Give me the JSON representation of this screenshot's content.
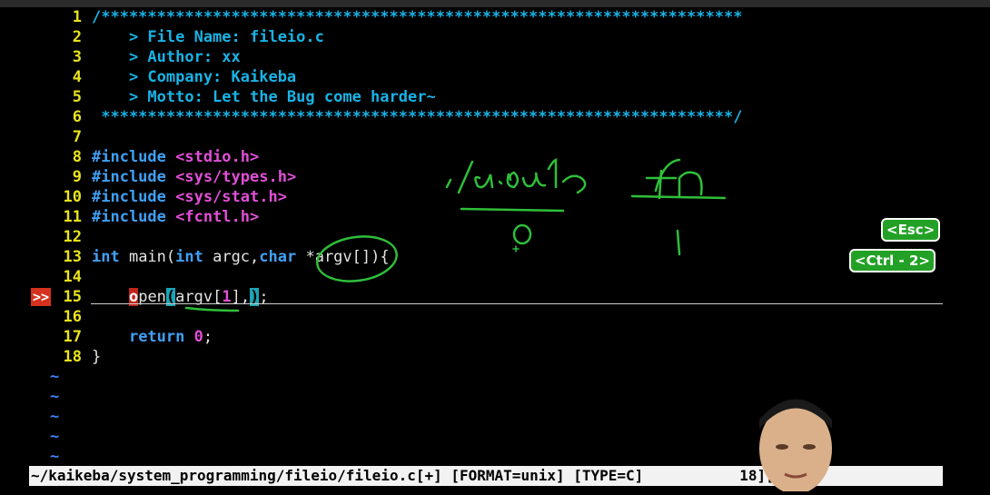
{
  "editor": {
    "lines": [
      {
        "num": "1",
        "segments": [
          {
            "cls": "cm",
            "text": "/*********************************************************************"
          }
        ]
      },
      {
        "num": "2",
        "segments": [
          {
            "cls": "cm",
            "text": "    > File Name: fileio.c"
          }
        ]
      },
      {
        "num": "3",
        "segments": [
          {
            "cls": "cm",
            "text": "    > Author: xx"
          }
        ]
      },
      {
        "num": "4",
        "segments": [
          {
            "cls": "cm",
            "text": "    > Company: Kaikeba"
          }
        ]
      },
      {
        "num": "5",
        "segments": [
          {
            "cls": "cm",
            "text": "    > Motto: Let the Bug come harder~"
          }
        ]
      },
      {
        "num": "6",
        "segments": [
          {
            "cls": "cm",
            "text": " ********************************************************************/"
          }
        ]
      },
      {
        "num": "7",
        "segments": []
      },
      {
        "num": "8",
        "segments": [
          {
            "cls": "pp",
            "text": "#include "
          },
          {
            "cls": "inc",
            "text": "<stdio.h>"
          }
        ]
      },
      {
        "num": "9",
        "segments": [
          {
            "cls": "pp",
            "text": "#include "
          },
          {
            "cls": "inc",
            "text": "<sys/types.h>"
          }
        ]
      },
      {
        "num": "10",
        "segments": [
          {
            "cls": "pp",
            "text": "#include "
          },
          {
            "cls": "inc",
            "text": "<sys/stat.h>"
          }
        ]
      },
      {
        "num": "11",
        "segments": [
          {
            "cls": "pp",
            "text": "#include "
          },
          {
            "cls": "inc",
            "text": "<fcntl.h>"
          }
        ]
      },
      {
        "num": "12",
        "segments": []
      },
      {
        "num": "13",
        "segments": [
          {
            "cls": "kw",
            "text": "int"
          },
          {
            "cls": "tx",
            "text": " main("
          },
          {
            "cls": "kw",
            "text": "int"
          },
          {
            "cls": "tx",
            "text": " argc,"
          },
          {
            "cls": "kw",
            "text": "char"
          },
          {
            "cls": "tx",
            "text": " *argv[]){"
          }
        ]
      },
      {
        "num": "14",
        "segments": []
      },
      {
        "num": "15",
        "segments": [
          {
            "cls": "tx",
            "text": "    "
          },
          {
            "cls": "cursor-hl",
            "text": "o"
          },
          {
            "cls": "tx",
            "text": "pen"
          },
          {
            "cls": "paren-hl",
            "text": "("
          },
          {
            "cls": "tx",
            "text": "argv["
          },
          {
            "cls": "numlit",
            "text": "1"
          },
          {
            "cls": "tx",
            "text": "],"
          },
          {
            "cls": "paren-hl",
            "text": ")"
          },
          {
            "cls": "tx",
            "text": ";"
          }
        ]
      },
      {
        "num": "16",
        "segments": []
      },
      {
        "num": "17",
        "segments": [
          {
            "cls": "tx",
            "text": "    "
          },
          {
            "cls": "kw",
            "text": "return"
          },
          {
            "cls": "tx",
            "text": " "
          },
          {
            "cls": "numlit",
            "text": "0"
          },
          {
            "cls": "tx",
            "text": ";"
          }
        ]
      },
      {
        "num": "18",
        "segments": [
          {
            "cls": "tx",
            "text": "}"
          }
        ]
      }
    ],
    "sign_marker": ">>",
    "tilde": "~"
  },
  "statusbar": {
    "text": "~/kaikeba/system_programming/fileio/fileio.c[+] [FORMAT=unix] [TYPE=C]           18][83%]"
  },
  "badges": {
    "esc": "<Esc>",
    "ctrl2": "<Ctrl - 2>"
  },
  "colors": {
    "comment": "#19b3e6",
    "keyword": "#3fa1f5",
    "include": "#e14fd6",
    "linenum": "#e9e31c",
    "annotation_ink": "#2fbf3a",
    "badge": "#23a126"
  }
}
